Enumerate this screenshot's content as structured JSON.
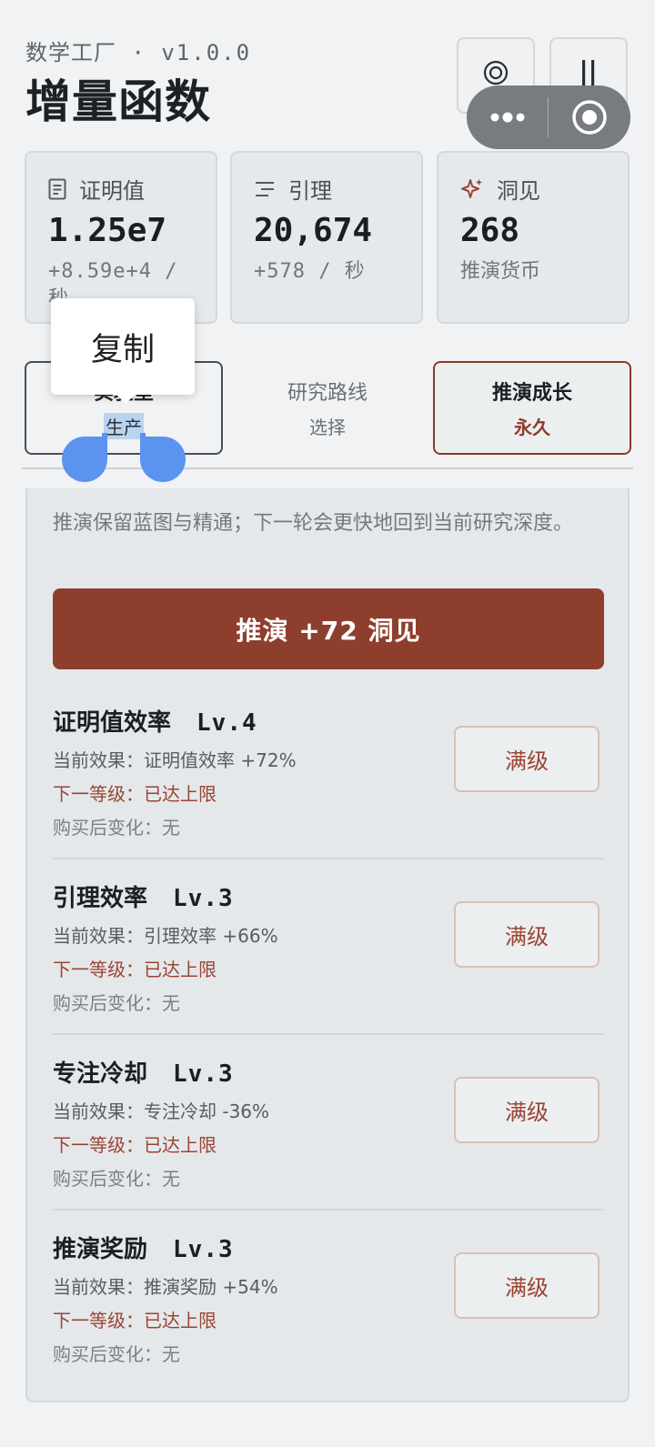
{
  "header": {
    "app_name": "数学工厂",
    "version": "· v1.0.0",
    "title": "增量函数"
  },
  "stats": {
    "proof": {
      "label": "证明值",
      "value": "1.25e7",
      "sub": "+8.59e+4 / 秒",
      "icon": "document-icon"
    },
    "lemma": {
      "label": "引理",
      "value": "20,674",
      "sub": "+578 / 秒",
      "icon": "sliders-icon"
    },
    "insight": {
      "label": "洞见",
      "value": "268",
      "sub": "推演货币",
      "icon": "sparkle-icon"
    }
  },
  "tabs": [
    {
      "label": "实验室",
      "sub": "生产"
    },
    {
      "label": "研究路线",
      "sub": "选择"
    },
    {
      "label": "推演成长",
      "sub": "永久"
    }
  ],
  "popup": {
    "copy_label": "复制"
  },
  "panel": {
    "description": "推演保留蓝图与精通；下一轮会更快地回到当前研究深度。",
    "ascend_button": "推演 +72 洞见"
  },
  "upgrades": [
    {
      "name": "证明值效率",
      "level": "Lv.4",
      "current": "当前效果：证明值效率 +72%",
      "next": "下一等级：已达上限",
      "after": "购买后变化：无",
      "button": "满级"
    },
    {
      "name": "引理效率",
      "level": "Lv.3",
      "current": "当前效果：引理效率 +66%",
      "next": "下一等级：已达上限",
      "after": "购买后变化：无",
      "button": "满级"
    },
    {
      "name": "专注冷却",
      "level": "Lv.3",
      "current": "当前效果：专注冷却 -36%",
      "next": "下一等级：已达上限",
      "after": "购买后变化：无",
      "button": "满级"
    },
    {
      "name": "推演奖励",
      "level": "Lv.3",
      "current": "当前效果：推演奖励 +54%",
      "next": "下一等级：已达上限",
      "after": "购买后变化：无",
      "button": "满级"
    }
  ],
  "colors": {
    "accent": "#8e3e2d",
    "selection_handle": "#5b93ee",
    "text_selection": "#b9d4ef"
  }
}
